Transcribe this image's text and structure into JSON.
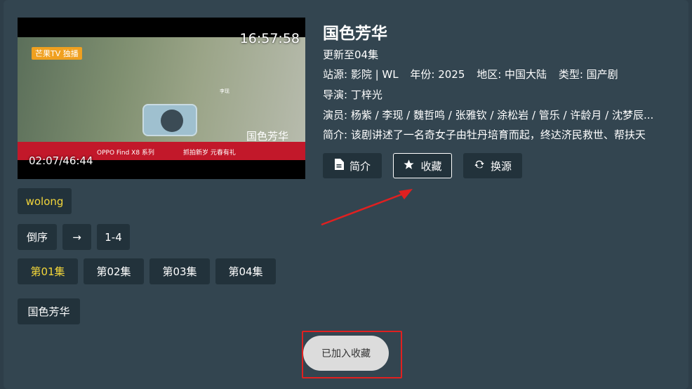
{
  "player": {
    "clock": "16:57:58",
    "progress": "02:07/46:44",
    "overlay_logo": "芒果TV 独播",
    "overlay_caption": "李现",
    "overlay_strip_left": "OPPO Find X8 系列",
    "overlay_strip_right": "抓拍新岁 元春有礼",
    "overlay_brand": "国色芳华"
  },
  "detail": {
    "title": "国色芳华",
    "update": "更新至04集",
    "source_label": "站源: ",
    "source_value": "影院 | WL",
    "year_label": "年份: ",
    "year_value": "2025",
    "region_label": "地区: ",
    "region_value": "中国大陆",
    "type_label": "类型: ",
    "type_value": "国产剧",
    "director": "导演: 丁梓光",
    "cast": "演员: 杨紫 / 李现 / 魏哲鸣 / 张雅钦 / 涂松岩 / 管乐 / 许龄月 / 沈梦辰...",
    "intro": "简介: 该剧讲述了一名奇女子由牡丹培育而起，终达济民救世、帮扶天"
  },
  "actions": {
    "intro_label": "简介",
    "collect_label": "收藏",
    "switch_source_label": "换源"
  },
  "source_tab": "wolong",
  "order": {
    "reverse_label": "倒序",
    "arrow": "→",
    "range": "1-4"
  },
  "episodes": [
    "第01集",
    "第02集",
    "第03集",
    "第04集"
  ],
  "active_episode": 0,
  "playlist_name": "国色芳华",
  "toast": "已加入收藏",
  "colors": {
    "background": "#334550",
    "button": "#22323b",
    "active_episode": "#f3d63a",
    "annotation": "#e02020"
  }
}
